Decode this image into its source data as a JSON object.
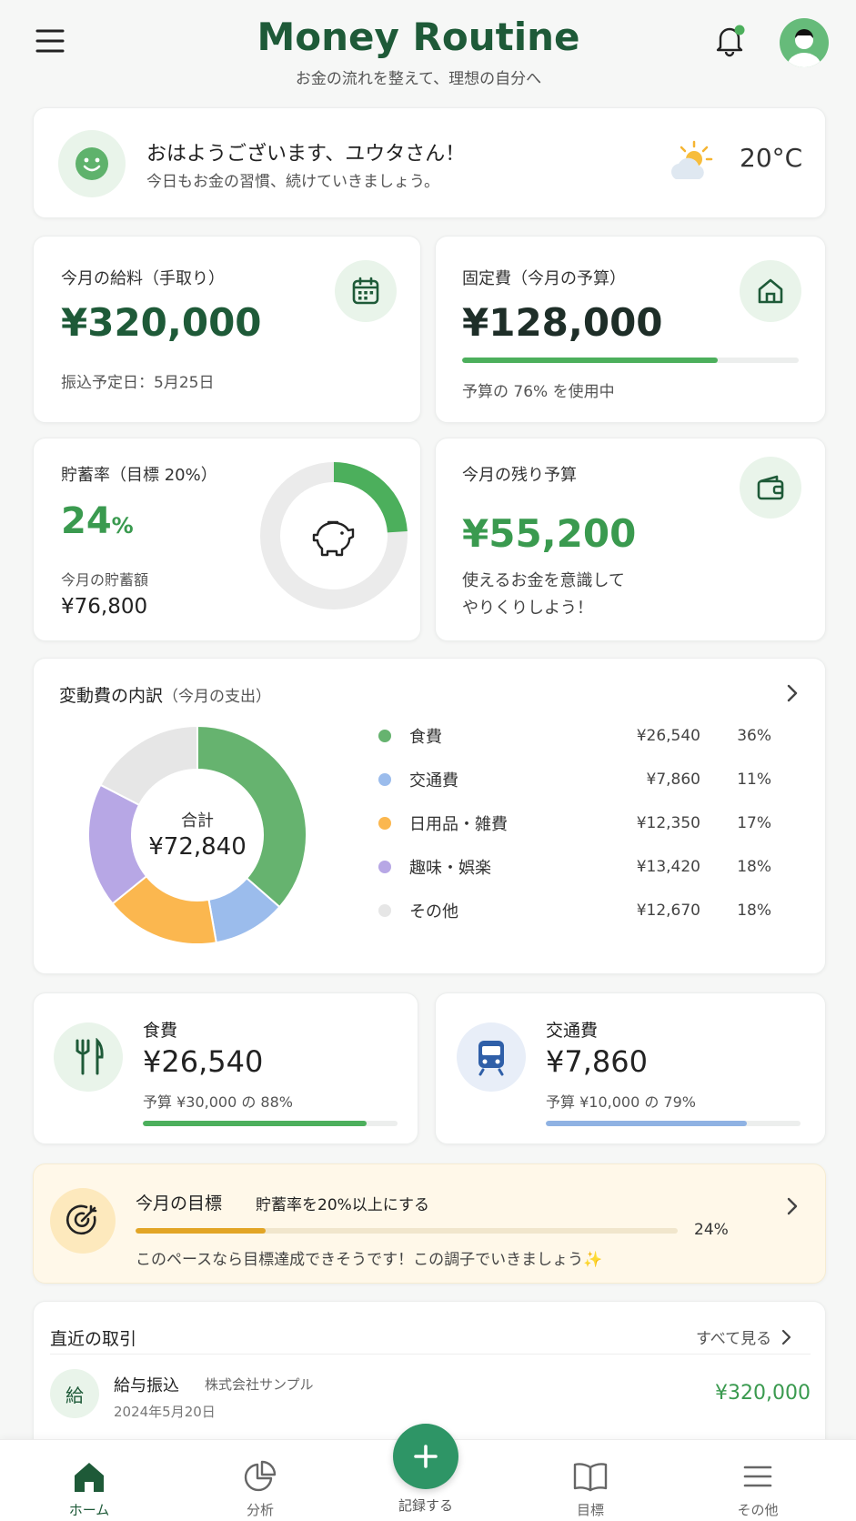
{
  "header": {
    "title": "Money Routine",
    "subtitle": "お金の流れを整えて、理想の自分へ"
  },
  "greeting": {
    "title": "おはようございます、ユウタさん！",
    "message": "今日もお金の習慣、続けていきましょう。",
    "temperature": "20°C",
    "weather_icon": "partly-sunny-icon"
  },
  "salary": {
    "label": "今月の給料（手取り）",
    "amount": "¥320,000",
    "note": "振込予定日：5月25日"
  },
  "fixed": {
    "label": "固定費（今月の予算）",
    "amount": "¥128,000",
    "note": "予算の 76% を使用中",
    "progress": 0.76
  },
  "savings": {
    "label": "貯蓄率（目標 20%）",
    "rate_value": "24",
    "rate_unit": "%",
    "amount_label": "今月の貯蓄額",
    "amount": "¥76,800",
    "rate": 0.24
  },
  "remaining": {
    "label": "今月の残り予算",
    "amount": "¥55,200",
    "line1": "使えるお金を意識して",
    "line2": "やりくりしよう！"
  },
  "breakdown": {
    "title": "変動費の内訳",
    "subtitle": "（今月の支出）",
    "total_label": "合計",
    "total": "¥72,840"
  },
  "chart_data": {
    "type": "pie",
    "categories": [
      "食費",
      "交通費",
      "日用品・雑費",
      "趣味・娯楽",
      "その他"
    ],
    "values": [
      26540,
      7860,
      12350,
      13420,
      12670
    ],
    "amounts": [
      "¥26,540",
      "¥7,860",
      "¥12,350",
      "¥13,420",
      "¥12,670"
    ],
    "percents": [
      "36%",
      "11%",
      "17%",
      "18%",
      "18%"
    ],
    "colors": [
      "#66b36f",
      "#9bbcec",
      "#fbb74f",
      "#b7a7e5",
      "#e6e6e6"
    ]
  },
  "food": {
    "label": "食費",
    "amount": "¥26,540",
    "note": "予算 ¥30,000 の 88%",
    "progress": 0.88,
    "color": "#4caf5c"
  },
  "transport": {
    "label": "交通費",
    "amount": "¥7,860",
    "note": "予算 ¥10,000 の 79%",
    "progress": 0.79,
    "color": "#8fb2e3"
  },
  "goal": {
    "label": "今月の目標",
    "text": "貯蓄率を20%以上にする",
    "percent": "24%",
    "progress": 0.24,
    "message": "このペースなら目標達成できそうです！この調子でいきましょう✨"
  },
  "transactions": {
    "title": "直近の取引",
    "see_all": "すべて見る",
    "items": [
      {
        "badge": "給",
        "name": "給与振込",
        "payer": "株式会社サンプル",
        "date": "2024年5月20日",
        "amount": "¥320,000"
      }
    ]
  },
  "nav": {
    "home": "ホーム",
    "analysis": "分析",
    "record": "記録する",
    "goals": "目標",
    "more": "その他"
  },
  "colors": {
    "accent": "#1e5a38",
    "green": "#3a9a4f",
    "fab": "#2e9566"
  }
}
